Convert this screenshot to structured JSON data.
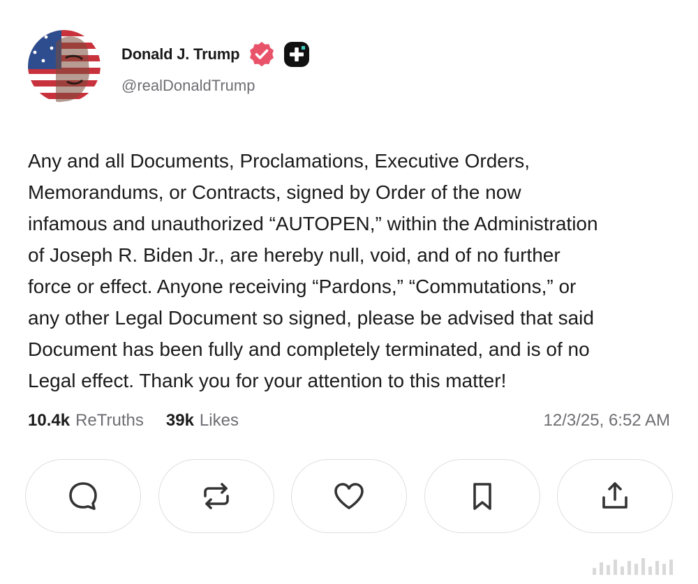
{
  "post": {
    "author": {
      "display_name": "Donald J. Trump",
      "handle": "@realDonaldTrump",
      "verified_badge_color": "#e8536a",
      "avatar_icon": "flag-portrait-avatar"
    },
    "body": "Any and all Documents, Proclamations, Executive Orders,\nMemorandums, or Contracts, signed by Order of the now\ninfamous and unauthorized “AUTOPEN,” within the Administration\nof Joseph R. Biden Jr., are hereby null, void, and of no further\nforce or effect. Anyone receiving “Pardons,” “Commutations,” or\nany other Legal Document so signed, please be advised that said\nDocument has been fully and completely terminated, and is of no\nLegal effect. Thank you for your attention to this matter!",
    "stats": {
      "retruths_count": "10.4k",
      "retruths_label": "ReTruths",
      "likes_count": "39k",
      "likes_label": "Likes"
    },
    "timestamp": "12/3/25, 6:52 AM"
  },
  "actions": [
    {
      "name": "reply",
      "icon": "comment-icon"
    },
    {
      "name": "retruth",
      "icon": "repost-icon"
    },
    {
      "name": "like",
      "icon": "heart-icon"
    },
    {
      "name": "bookmark",
      "icon": "bookmark-icon"
    },
    {
      "name": "share",
      "icon": "share-icon"
    }
  ],
  "colors": {
    "text_primary": "#1a1a1a",
    "text_secondary": "#6e6e73",
    "button_border": "#dedede",
    "icon_stroke": "#333333"
  }
}
